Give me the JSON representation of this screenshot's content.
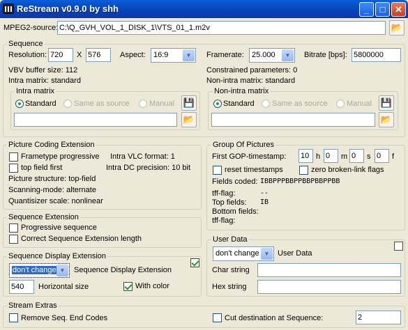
{
  "window": {
    "title": "ReStream v0.9.0 by shh"
  },
  "mpeg2": {
    "label": "MPEG2-source:",
    "path": "C:\\Q_GVH_VOL_1_DISK_1\\VTS_01_1.m2v"
  },
  "sequence": {
    "title": "Sequence",
    "resolution_label": "Resolution:",
    "width": "720",
    "x": "X",
    "height": "576",
    "aspect_label": "Aspect:",
    "aspect": "16:9",
    "framerate_label": "Framerate:",
    "framerate": "25.000",
    "bitrate_label": "Bitrate [bps]:",
    "bitrate": "5800000",
    "vbv": "VBV buffer size: 112",
    "constrained": "Constrained parameters: 0",
    "intra": "Intra matrix: standard",
    "nonintra": "Non-intra matrix: standard"
  },
  "intra_matrix": {
    "title": "Intra matrix",
    "standard": "Standard",
    "same": "Same as source",
    "manual": "Manual",
    "path": ""
  },
  "nonintra_matrix": {
    "title": "Non-intra matrix",
    "standard": "Standard",
    "same": "Same as source",
    "manual": "Manual",
    "path": ""
  },
  "pce": {
    "title": "Picture Coding Extension",
    "frametype": "Frametype progressive",
    "vlc": "Intra VLC format: 1",
    "topfield": "top field first",
    "dc": "Intra DC precision: 10 bit",
    "structure": "Picture structure: top-field",
    "scanning": "Scanning-mode: alternate",
    "quant": "Quantisizer scale: nonlinear"
  },
  "gop": {
    "title": "Group Of Pictures",
    "first_label": "First GOP-timestamp:",
    "h": "10",
    "h_u": "h",
    "m": "0",
    "m_u": "m",
    "s": "0",
    "s_u": "s",
    "f": "0",
    "f_u": "f",
    "reset": "reset timestamps",
    "zero": "zero broken-link flags",
    "fields_label": "Fields coded:",
    "fields": "IBBPPPBBPPBBPBBPPBB",
    "tff_label": "tff-flag:",
    "tff": "--",
    "top_label": "Top fields:",
    "top": "IB",
    "bottom_label": "Bottom fields:",
    "tff2_label": "tff-flag:"
  },
  "seqext": {
    "title": "Sequence Extension",
    "progressive": "Progressive sequence",
    "correct": "Correct Sequence Extension length"
  },
  "sde": {
    "title": "Sequence Display Extension",
    "select": "don't change",
    "label": "Sequence Display Extension",
    "hsize": "540",
    "hsize_label": "Horizontal size",
    "withcolor": "With color"
  },
  "userdata": {
    "title": "User Data",
    "select": "don't change",
    "label": "User Data",
    "char_label": "Char string",
    "hex_label": "Hex string"
  },
  "extras": {
    "title": "Stream Extras",
    "remove": "Remove Seq. End Codes",
    "cut": "Cut destination at Sequence:",
    "cut_value": "2"
  }
}
